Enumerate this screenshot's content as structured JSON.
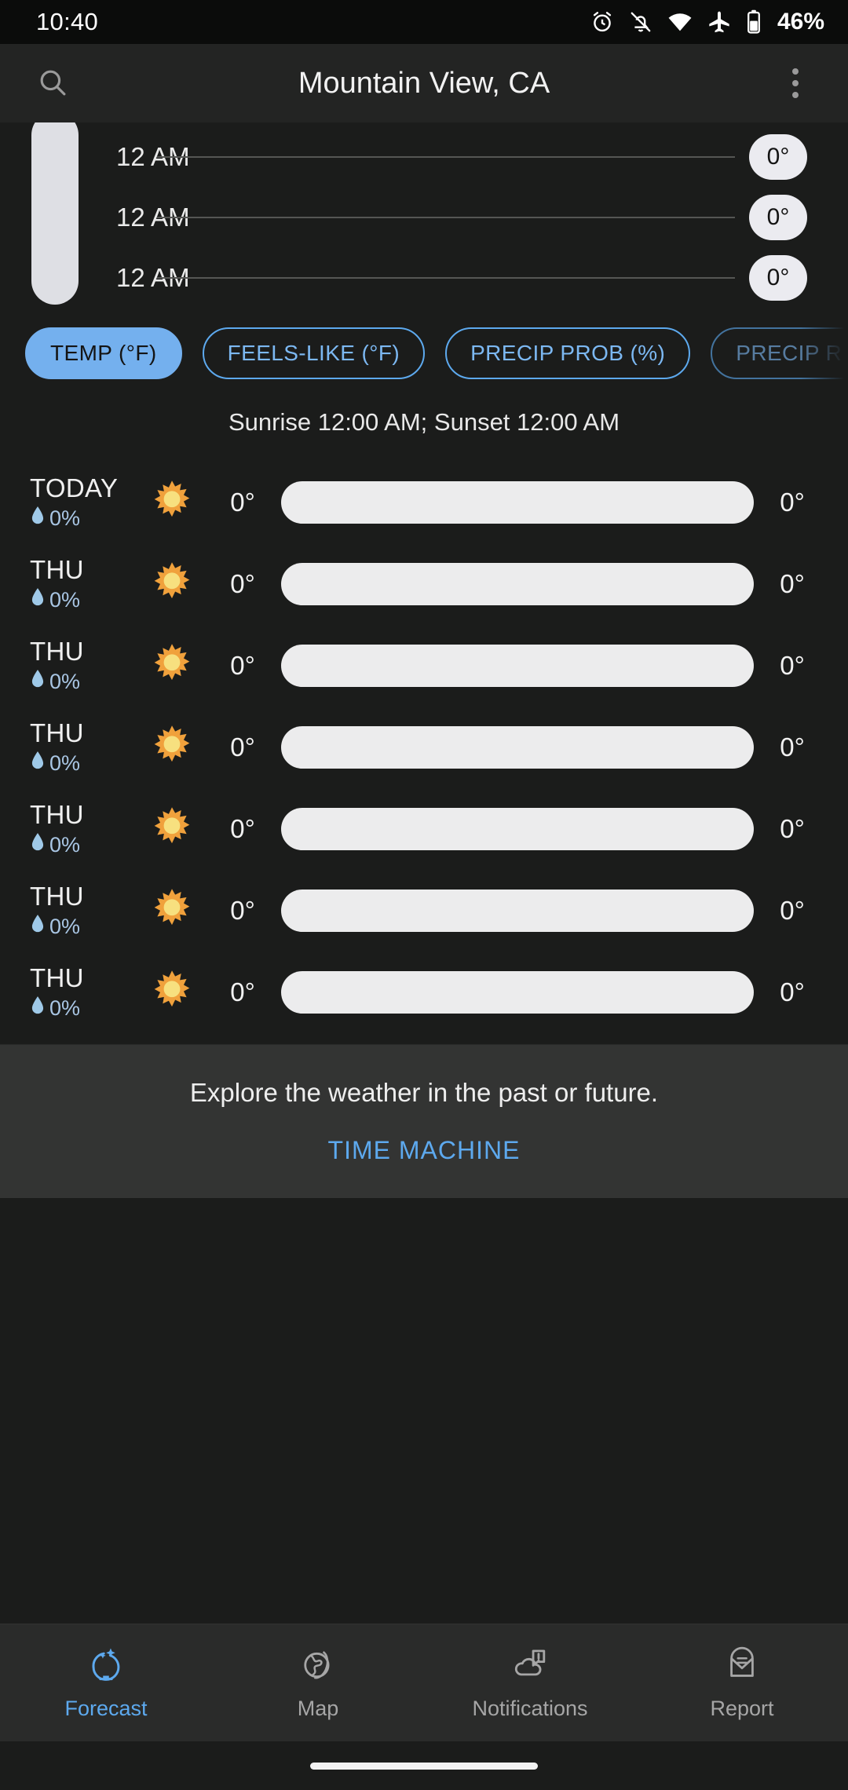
{
  "statusbar": {
    "time": "10:40",
    "battery": "46%",
    "icons": [
      "alarm-icon",
      "notifications-off-icon",
      "wifi-icon",
      "airplane-mode-icon",
      "battery-icon"
    ]
  },
  "appbar": {
    "title": "Mountain View, CA",
    "search_icon": "search-icon",
    "overflow_icon": "overflow-menu-icon"
  },
  "hourly": {
    "rows": [
      {
        "time": "12 AM",
        "temp": "0°"
      },
      {
        "time": "12 AM",
        "temp": "0°"
      },
      {
        "time": "12 AM",
        "temp": "0°"
      }
    ]
  },
  "chips": [
    {
      "label": "TEMP (°F)",
      "selected": true
    },
    {
      "label": "FEELS-LIKE (°F)",
      "selected": false
    },
    {
      "label": "PRECIP PROB (%)",
      "selected": false
    },
    {
      "label": "PRECIP R",
      "selected": false
    }
  ],
  "suntimes": "Sunrise 12:00 AM; Sunset 12:00 AM",
  "daily": [
    {
      "day": "TODAY",
      "pop": "0%",
      "icon": "sun-icon",
      "low": "0°",
      "high": "0°"
    },
    {
      "day": "THU",
      "pop": "0%",
      "icon": "sun-icon",
      "low": "0°",
      "high": "0°"
    },
    {
      "day": "THU",
      "pop": "0%",
      "icon": "sun-icon",
      "low": "0°",
      "high": "0°"
    },
    {
      "day": "THU",
      "pop": "0%",
      "icon": "sun-icon",
      "low": "0°",
      "high": "0°"
    },
    {
      "day": "THU",
      "pop": "0%",
      "icon": "sun-icon",
      "low": "0°",
      "high": "0°"
    },
    {
      "day": "THU",
      "pop": "0%",
      "icon": "sun-icon",
      "low": "0°",
      "high": "0°"
    },
    {
      "day": "THU",
      "pop": "0%",
      "icon": "sun-icon",
      "low": "0°",
      "high": "0°"
    }
  ],
  "timemachine": {
    "text": "Explore the weather in the past or future.",
    "link": "TIME MACHINE"
  },
  "bottomnav": [
    {
      "label": "Forecast",
      "icon": "crystal-ball-icon",
      "active": true
    },
    {
      "label": "Map",
      "icon": "globe-icon",
      "active": false
    },
    {
      "label": "Notifications",
      "icon": "cloud-alert-icon",
      "active": false
    },
    {
      "label": "Report",
      "icon": "envelope-icon",
      "active": false
    }
  ],
  "colors": {
    "accent": "#5da9ee",
    "chip_selected": "#74b0ee",
    "background": "#1b1c1b",
    "card": "#333433",
    "sun_ray": "#f0a13c",
    "sun_core": "#f7e07f",
    "droplet": "#9fc9e8"
  }
}
